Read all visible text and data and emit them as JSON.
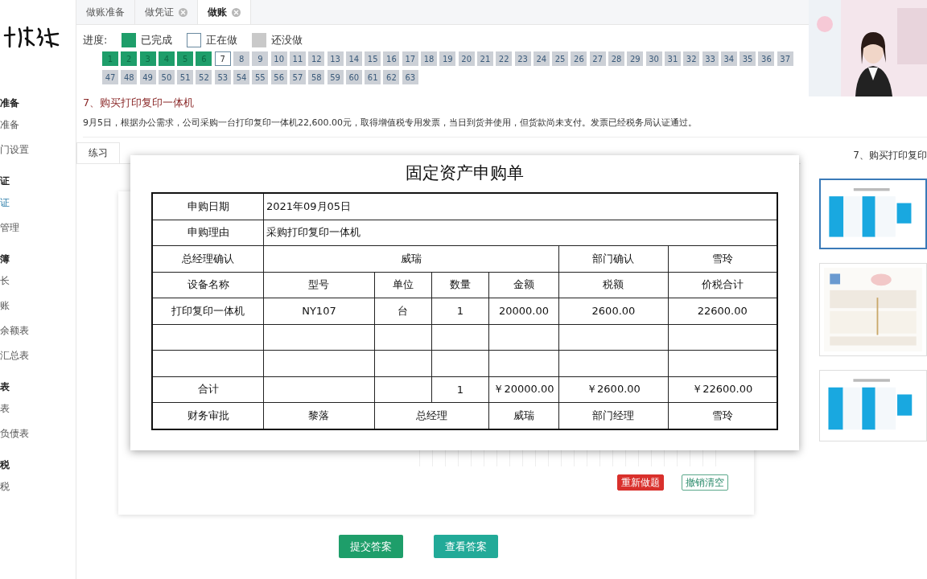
{
  "sidebar": {
    "groups": [
      {
        "title": "准备",
        "items": [
          {
            "label": "准备",
            "selected": false
          },
          {
            "label": "门设置",
            "selected": false
          }
        ]
      },
      {
        "title": "证",
        "items": [
          {
            "label": "证",
            "selected": true
          },
          {
            "label": "管理",
            "selected": false
          }
        ]
      },
      {
        "title": "簿",
        "items": [
          {
            "label": "长",
            "selected": false
          },
          {
            "label": "账",
            "selected": false
          },
          {
            "label": "余额表",
            "selected": false
          },
          {
            "label": "汇总表",
            "selected": false
          }
        ]
      },
      {
        "title": "表",
        "items": [
          {
            "label": "表",
            "selected": false
          },
          {
            "label": "负债表",
            "selected": false
          }
        ]
      },
      {
        "title": "税",
        "items": [
          {
            "label": "税",
            "selected": false
          }
        ]
      }
    ]
  },
  "tabs": [
    {
      "label": "做账准备",
      "selected": false,
      "closable": false
    },
    {
      "label": "做凭证",
      "selected": false,
      "closable": true
    },
    {
      "label": "做账",
      "selected": true,
      "closable": true
    }
  ],
  "progress": {
    "label": "进度:",
    "legend": [
      {
        "kind": "done",
        "label": "已完成"
      },
      {
        "kind": "current",
        "label": "正在做"
      },
      {
        "kind": "todo",
        "label": "还没做"
      }
    ],
    "rows": [
      [
        {
          "label": "1",
          "done": true,
          "current": false
        },
        {
          "label": "2",
          "done": true,
          "current": false
        },
        {
          "label": "3",
          "done": true,
          "current": false
        },
        {
          "label": "4",
          "done": true,
          "current": false
        },
        {
          "label": "5",
          "done": true,
          "current": false
        },
        {
          "label": "6",
          "done": true,
          "current": false
        },
        {
          "label": "7",
          "done": false,
          "current": true
        },
        {
          "label": "8",
          "done": false,
          "current": false
        },
        {
          "label": "9",
          "done": false,
          "current": false
        },
        {
          "label": "10",
          "done": false,
          "current": false
        },
        {
          "label": "11",
          "done": false,
          "current": false
        },
        {
          "label": "12",
          "done": false,
          "current": false
        },
        {
          "label": "13",
          "done": false,
          "current": false
        },
        {
          "label": "14",
          "done": false,
          "current": false
        },
        {
          "label": "15",
          "done": false,
          "current": false
        },
        {
          "label": "16",
          "done": false,
          "current": false
        },
        {
          "label": "17",
          "done": false,
          "current": false
        },
        {
          "label": "18",
          "done": false,
          "current": false
        },
        {
          "label": "19",
          "done": false,
          "current": false
        },
        {
          "label": "20",
          "done": false,
          "current": false
        },
        {
          "label": "21",
          "done": false,
          "current": false
        },
        {
          "label": "22",
          "done": false,
          "current": false
        },
        {
          "label": "23",
          "done": false,
          "current": false
        },
        {
          "label": "24",
          "done": false,
          "current": false
        },
        {
          "label": "25",
          "done": false,
          "current": false
        },
        {
          "label": "26",
          "done": false,
          "current": false
        },
        {
          "label": "27",
          "done": false,
          "current": false
        },
        {
          "label": "28",
          "done": false,
          "current": false
        },
        {
          "label": "29",
          "done": false,
          "current": false
        },
        {
          "label": "30",
          "done": false,
          "current": false
        },
        {
          "label": "31",
          "done": false,
          "current": false
        },
        {
          "label": "32",
          "done": false,
          "current": false
        },
        {
          "label": "33",
          "done": false,
          "current": false
        },
        {
          "label": "34",
          "done": false,
          "current": false
        },
        {
          "label": "35",
          "done": false,
          "current": false
        },
        {
          "label": "36",
          "done": false,
          "current": false
        },
        {
          "label": "37",
          "done": false,
          "current": false
        }
      ],
      [
        {
          "label": "47",
          "done": false,
          "current": false
        },
        {
          "label": "48",
          "done": false,
          "current": false
        },
        {
          "label": "49",
          "done": false,
          "current": false
        },
        {
          "label": "50",
          "done": false,
          "current": false
        },
        {
          "label": "51",
          "done": false,
          "current": false
        },
        {
          "label": "52",
          "done": false,
          "current": false
        },
        {
          "label": "53",
          "done": false,
          "current": false
        },
        {
          "label": "54",
          "done": false,
          "current": false
        },
        {
          "label": "55",
          "done": false,
          "current": false
        },
        {
          "label": "56",
          "done": false,
          "current": false
        },
        {
          "label": "57",
          "done": false,
          "current": false
        },
        {
          "label": "58",
          "done": false,
          "current": false
        },
        {
          "label": "59",
          "done": false,
          "current": false
        },
        {
          "label": "60",
          "done": false,
          "current": false
        },
        {
          "label": "61",
          "done": false,
          "current": false
        },
        {
          "label": "62",
          "done": false,
          "current": false
        },
        {
          "label": "63",
          "done": false,
          "current": false
        }
      ]
    ]
  },
  "question": {
    "title": "7、购买打印复印一体机",
    "text": "9月5日，根据办公需求，公司采购一台打印复印一体机22,600.00元，取得增值税专用发票，当日到货并使用，但货款尚未支付。发票已经税务局认证通过。"
  },
  "work_tabs": [
    {
      "label": "练习",
      "selected": true
    }
  ],
  "actions": [
    {
      "label": "重新做题",
      "kind": "danger"
    },
    {
      "label": "撤销清空",
      "kind": "outline"
    }
  ],
  "buttons": [
    {
      "label": "提交答案",
      "kind": "primary"
    },
    {
      "label": "查看答案",
      "kind": "teal"
    }
  ],
  "document": {
    "title": "固定资产申购单",
    "rows": [
      {
        "kind": "wide",
        "cells": [
          "申购日期",
          {
            "text": "2021年09月05日",
            "colspan": 6
          }
        ]
      },
      {
        "kind": "wide",
        "cells": [
          "申购理由",
          {
            "text": "采购打印复印一体机",
            "colspan": 6
          }
        ]
      },
      {
        "kind": "confirm",
        "cells": [
          "总经理确认",
          {
            "text": "威瑞",
            "colspan": 4
          },
          "部门确认",
          "雪玲"
        ]
      },
      {
        "kind": "full",
        "cells": [
          "设备名称",
          "型号",
          "单位",
          "数量",
          "金额",
          "税额",
          "价税合计"
        ]
      },
      {
        "kind": "full",
        "cells": [
          "打印复印一体机",
          "NY107",
          "台",
          "1",
          "20000.00",
          "2600.00",
          "22600.00"
        ]
      },
      {
        "kind": "full",
        "cells": [
          "",
          "",
          "",
          "",
          "",
          "",
          ""
        ]
      },
      {
        "kind": "full",
        "cells": [
          "",
          "",
          "",
          "",
          "",
          "",
          ""
        ]
      },
      {
        "kind": "full",
        "cells": [
          "合计",
          "",
          "",
          "1",
          "￥20000.00",
          "￥2600.00",
          "￥22600.00"
        ]
      },
      {
        "kind": "approval",
        "cells": [
          "财务审批",
          "黎落",
          {
            "text": "总经理",
            "colspan": 2
          },
          "威瑞",
          "部门经理",
          "雪玲"
        ]
      }
    ]
  },
  "attachments": {
    "title": "7、购买打印复印",
    "items": [
      {
        "kind": "picture",
        "selected": true
      },
      {
        "kind": "picture",
        "selected": false
      },
      {
        "kind": "picture",
        "selected": false
      }
    ]
  }
}
